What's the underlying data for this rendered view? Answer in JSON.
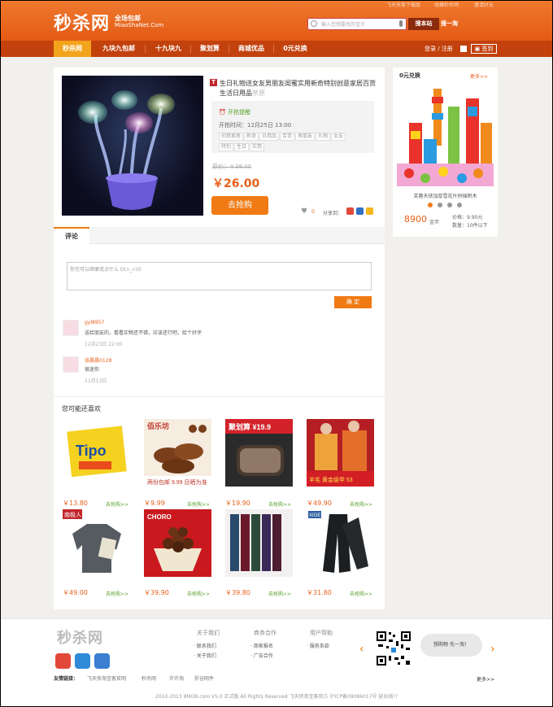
{
  "header": {
    "logo": "秒杀网",
    "logo_sub1": "全场包邮",
    "logo_sub2": "MiaoShaNet.Com",
    "top_links": [
      "飞天侠客下载版",
      "收藏秒杀网",
      "邀请好友"
    ],
    "search_placeholder": "输入您想要找的宝贝",
    "search_button": "搜本站",
    "search_button2": "搜一淘",
    "nav": [
      "秒杀网",
      "九块九包邮",
      "十九块九",
      "聚划算",
      "商城优品",
      "0元兑换"
    ],
    "login": "登录 / 注册",
    "signin": "签到"
  },
  "product": {
    "tag": "T",
    "title": "生日礼物送女友男朋友闺蜜实用新奇特别创意家居百货生活日用品",
    "title_more": "草原",
    "remind": "开抢提醒",
    "start_time": "开抢时间：12月25日 13:00",
    "tags": [
      "创意家居",
      "新奇",
      "日用品",
      "百货",
      "男朋友",
      "礼物",
      "女友",
      "特别",
      "生日",
      "实用"
    ],
    "original_price": "原价：￥39.00",
    "price": "￥26.00",
    "buy_button": "去抢购",
    "likes": "0",
    "share_label": "分享到："
  },
  "comments": {
    "tab": "评论",
    "placeholder": "你也可以顺便说点什么 O(∩_∩)O",
    "submit": "确 定",
    "items": [
      {
        "name": "gyl8957",
        "text": "送给朋友的，看看实物还不错，应该还行吧，给个好评",
        "date": "12月23日 22:00"
      },
      {
        "name": "张晨晨0128",
        "text": "很迷你",
        "date": "11月13日"
      }
    ]
  },
  "may_like": {
    "title": "您可能还喜欢",
    "go_label": "去抢购>>",
    "items": [
      {
        "price": "￥13.80",
        "img_text": "Tipo"
      },
      {
        "price": "￥9.99",
        "img_text": "两份包邮 9.99 目晒为准",
        "brand": "佰乐坊"
      },
      {
        "price": "￥19.90",
        "img_text": "聚划算 ¥19.9"
      },
      {
        "price": "￥49.90",
        "img_text": "羊毛 黄金级甲 53"
      },
      {
        "price": "￥49.00",
        "img_text": "南极人"
      },
      {
        "price": "￥39.90",
        "img_text": "CHORO"
      },
      {
        "price": "￥39.80",
        "img_text": ""
      },
      {
        "price": "￥31.80",
        "img_text": "XIGE"
      }
    ]
  },
  "right_panel": {
    "title": "0元兑换",
    "more": "更多>>",
    "item_name": "芙蓉天侠加厚雪花片拼插积木",
    "price": "8900",
    "unit": "金币",
    "orig_price": "价格：9.90元",
    "qty": "数量：10件以下"
  },
  "footer": {
    "logo": "秒杀网",
    "cols": [
      {
        "title": "关于我们",
        "items": [
          "联系我们",
          "关于我们"
        ]
      },
      {
        "title": "商务合作",
        "items": [
          "商家报名",
          "广告合作"
        ]
      },
      {
        "title": "用户帮助",
        "items": [
          "服务条款"
        ]
      }
    ],
    "bubble": "想购物 先一淘！",
    "links_label": "友情链接：",
    "links": [
      "飞天侠淘宝客官网",
      "秒杀网",
      "许许淘",
      "折谷网件"
    ],
    "more": "更多>>",
    "copyright": "2010-2013 8MOB.com V5.0 正式版 All Rights Reserved 飞天侠淘宝客官方 沪ICP备09086017号 延长线!?"
  }
}
